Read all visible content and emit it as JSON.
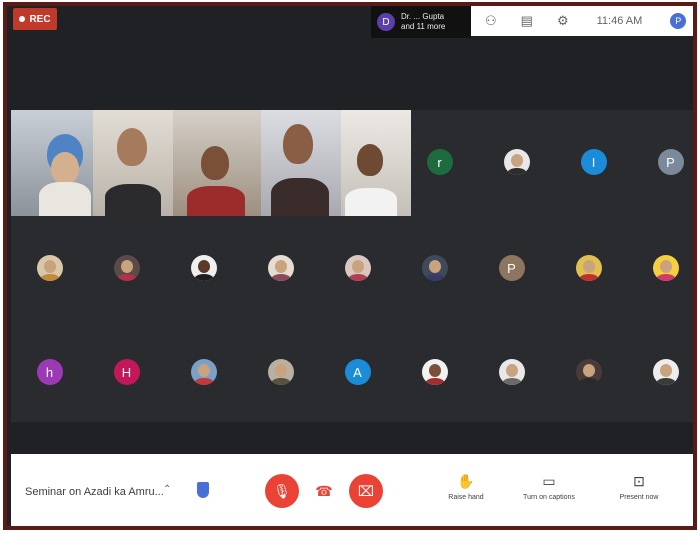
{
  "recording": {
    "label": "REC"
  },
  "notification": {
    "avatar_letter": "D",
    "line1": "Dr. ... Gupta",
    "line2": "and 11 more"
  },
  "topbar": {
    "time": "11:46 AM",
    "user_initial": "P"
  },
  "participants": {
    "row1_initials": [
      "r",
      "",
      "I",
      "P"
    ],
    "row2_initials": [
      "",
      "",
      "",
      "",
      "",
      "",
      "P",
      "",
      ""
    ],
    "row3_initials": [
      "h",
      "H",
      "",
      "",
      "A",
      "",
      "",
      "",
      ""
    ]
  },
  "bottom_bar": {
    "meeting_title": "Seminar on Azadi ka Amru...",
    "raise_hand_label": "Raise hand",
    "captions_label": "Turn on captions",
    "present_label": "Present now"
  },
  "colors": {
    "frame_border": "#5a1a16",
    "grid_bg": "#2a2b2e",
    "red_control": "#ea4335",
    "accent_blue": "#4a6fd6"
  }
}
